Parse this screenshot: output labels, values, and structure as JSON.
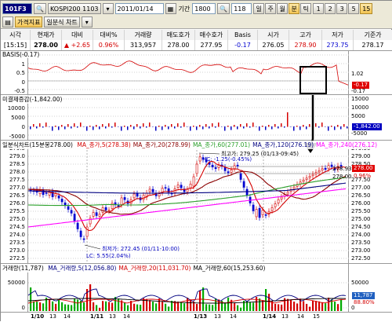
{
  "toolbar": {
    "code": "101F3",
    "mode_1": "가격지표",
    "mode_2": "일분식 차트",
    "index_code": "KOSPI200",
    "index_time": "1103",
    "date": "2011/01/14",
    "period_label": "기간",
    "period_value": "1800",
    "interval_value": "118",
    "unit_btns": [
      "일",
      "주",
      "월",
      "분",
      "틱"
    ],
    "num_btns": [
      "1",
      "2",
      "3",
      "5",
      "15"
    ],
    "active_unit": "분",
    "active_num": "15"
  },
  "quote": {
    "headers": [
      "시각",
      "현재가",
      "대비",
      "대비%",
      "거래량",
      "매도호가",
      "매수호가",
      "Basis",
      "시가",
      "고가",
      "저가",
      "기준가"
    ],
    "values": [
      "[15:15]",
      "278.00",
      "▲ +2.65",
      "0.96%",
      "313,957",
      "278.00",
      "277.95",
      "-0.17",
      "276.05",
      "278.90",
      "273.75",
      "278.17"
    ],
    "value_colors": [
      "#000000",
      "#000000",
      "#d40000",
      "#d40000",
      "#000000",
      "#000000",
      "#000000",
      "#0000d0",
      "#000000",
      "#d40000",
      "#0000d0",
      "#000000"
    ]
  },
  "basis_panel": {
    "title": "BASIS(-0.17)",
    "left_ticks": [
      "1.5",
      "1",
      "0.5",
      "0",
      "-0.5"
    ],
    "right_ticks": [
      "1.02",
      "-0.17"
    ],
    "current_tag": "-0.17",
    "current_tag_color": "#e00000"
  },
  "oi_panel": {
    "title": "미결제증감(-1,842.00)",
    "left_ticks": [
      "15000",
      "10000",
      "5000",
      "0",
      "-5000"
    ],
    "right_ticks": [
      "15000",
      "10000",
      "5000",
      "-5000"
    ],
    "current_tag": "-1,842.00",
    "current_tag_color": "#0000c0"
  },
  "price_panel": {
    "title": "일분식차트(15분봉278.00)",
    "ma_legend": [
      {
        "label": "MA_종가,5(278.38)",
        "color": "#d40000"
      },
      {
        "label": "MA_종가,20(278.99)",
        "color": "#8b0000"
      },
      {
        "label": "MA_종가,60(277.01)",
        "color": "#2ca02c"
      },
      {
        "label": "MA_종가,120(276.19)",
        "color": "#000080"
      },
      {
        "label": "MA_종가,240(276.12)",
        "color": "#ff00ff"
      }
    ],
    "left_ticks": [
      "279.5",
      "279.0",
      "278.5",
      "278.0",
      "277.5",
      "277.0",
      "276.5",
      "276.0",
      "275.5",
      "275.0",
      "274.5",
      "274.0",
      "273.5",
      "273.0",
      "272.5"
    ],
    "right_ticks": [
      "279.50",
      "279.00",
      "278.50",
      "277.50",
      "277.00",
      "276.50",
      "276.00",
      "275.50",
      "275.00",
      "274.50",
      "274.00",
      "273.50",
      "273.00",
      "272.50"
    ],
    "high_label": "최고가: 279.25 (01/13-09:45)",
    "hc_label": "HC: -1.25(-0.45%)",
    "low_label": "최저가: 272.45 (01/11-10:00)",
    "lc_label": "LC: 5.55(2.04%)",
    "value_278_93": "278.93",
    "value_278_00": "278.00",
    "current_tag": "278.00",
    "current_pct": "0.96%"
  },
  "volume_panel": {
    "title": "거래량(11,787)",
    "ma_legend": [
      {
        "label": "MA_거래량,5(12,056.80)",
        "color": "#000080"
      },
      {
        "label": "MA_거래량,20(11,031.70)",
        "color": "#d40000"
      },
      {
        "label": "MA_거래량,60(15,253.60)",
        "color": "#000000"
      }
    ],
    "left_ticks": [
      "50000",
      "0"
    ],
    "right_ticks": [
      "50000",
      "0"
    ],
    "current_tag": "11,787",
    "current_pct": "88.80%"
  },
  "xaxis": {
    "labels": [
      {
        "text": "1/10",
        "bold": true
      },
      {
        "text": "13",
        "bold": false
      },
      {
        "text": "14",
        "bold": false
      },
      {
        "text": "1/11",
        "bold": true
      },
      {
        "text": "13",
        "bold": false
      },
      {
        "text": "14",
        "bold": false
      },
      {
        "text": "1/13",
        "bold": true
      },
      {
        "text": "13",
        "bold": false
      },
      {
        "text": "14",
        "bold": false
      },
      {
        "text": "1/14",
        "bold": true
      },
      {
        "text": "13",
        "bold": false
      },
      {
        "text": "14",
        "bold": false
      },
      {
        "text": "15",
        "bold": false
      }
    ]
  }
}
